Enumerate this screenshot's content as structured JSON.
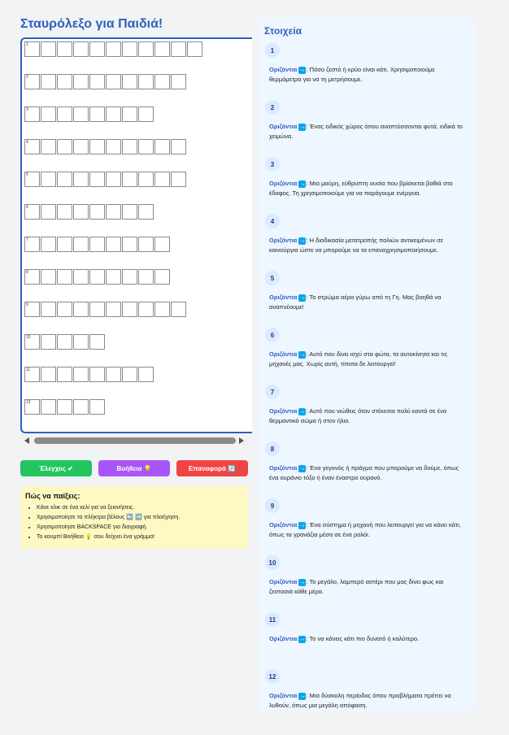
{
  "title": "Σταυρόλεξο για Παιδιά!",
  "grid": {
    "rows": [
      {
        "number": "1",
        "length": 11
      },
      {
        "number": "2",
        "length": 10
      },
      {
        "number": "3",
        "length": 8
      },
      {
        "number": "4",
        "length": 10
      },
      {
        "number": "5",
        "length": 10
      },
      {
        "number": "6",
        "length": 8
      },
      {
        "number": "7",
        "length": 9
      },
      {
        "number": "8",
        "length": 9
      },
      {
        "number": "9",
        "length": 10
      },
      {
        "number": "10",
        "length": 5
      },
      {
        "number": "11",
        "length": 8
      },
      {
        "number": "12",
        "length": 5
      }
    ]
  },
  "buttons": {
    "check": "Έλεγχος ✔",
    "help": "Βοήθεια 💡",
    "reset": "Επαναφορά 🔄"
  },
  "instructions": {
    "title": "Πώς να παίξεις:",
    "items": [
      "Κάνε κλικ σε ένα κελί για να ξεκινήσεις.",
      "Χρησιμοποίησε τα πλήκτρα βέλους ⬅️ ➡️ για πλοήγηση.",
      "Χρησιμοποίησε BACKSPACE για διαγραφή.",
      "Το κουμπί Βοήθεια 💡 σου δείχνει ένα γράμμα!"
    ]
  },
  "clues": {
    "title": "Στοιχεία",
    "direction_label": "Οριζόντια",
    "items": [
      {
        "number": "1",
        "text": ": Πόσο ζεστό ή κρύο είναι κάτι. Χρησιμοποιούμε θερμόμετρα για να τη μετρήσουμε."
      },
      {
        "number": "2",
        "text": ": Ένας ειδικός χώρος όπου αναπτύσσονται φυτά, ειδικά το χειμώνα."
      },
      {
        "number": "3",
        "text": ": Μια μαύρη, εύθρυπτη ουσία που βρίσκεται βαθιά στο έδαφος. Τη χρησιμοποιούμε για να παράγουμε ενέργεια."
      },
      {
        "number": "4",
        "text": ": Η διαδικασία μετατροπής παλιών αντικειμένων σε καινούργια ώστε να μπορούμε να τα επαναχρησιμοποιήσουμε."
      },
      {
        "number": "5",
        "text": ": Το στρώμα αέρα γύρω από τη Γη. Μας βοηθά να αναπνέουμε!"
      },
      {
        "number": "6",
        "text": ": Αυτό που δίνει ισχύ στα φώτα, τα αυτοκίνητα και τις μηχανές μας. Χωρίς αυτή, τίποτα δε λειτουργεί!"
      },
      {
        "number": "7",
        "text": ": Αυτό που νιώθεις όταν στέκεσαι πολύ κοντά σε ένα θερμαντικό σώμα ή στον ήλιο."
      },
      {
        "number": "8",
        "text": ": Ένα γεγονός ή πράγμα που μπορούμε να δούμε, όπως ένα ουράνιο τόξο ή έναν έναστρο ουρανό."
      },
      {
        "number": "9",
        "text": ": Ένα σύστημα ή μηχανή που λειτουργεί για να κάνει κάτι, όπως τα γρανάζια μέσα σε ένα ρολόι."
      },
      {
        "number": "10",
        "text": ": Το μεγάλο, λαμπερό αστέρι που μας δίνει φως και ζεστασιά κάθε μέρα."
      },
      {
        "number": "11",
        "text": ": Το να κάνεις κάτι πιο δυνατό ή καλύτερο."
      },
      {
        "number": "12",
        "text": ": Μια δύσκολη περίοδος όπου προβλήματα πρέπει να λυθούν, όπως μια μεγάλη απόφαση."
      }
    ]
  }
}
